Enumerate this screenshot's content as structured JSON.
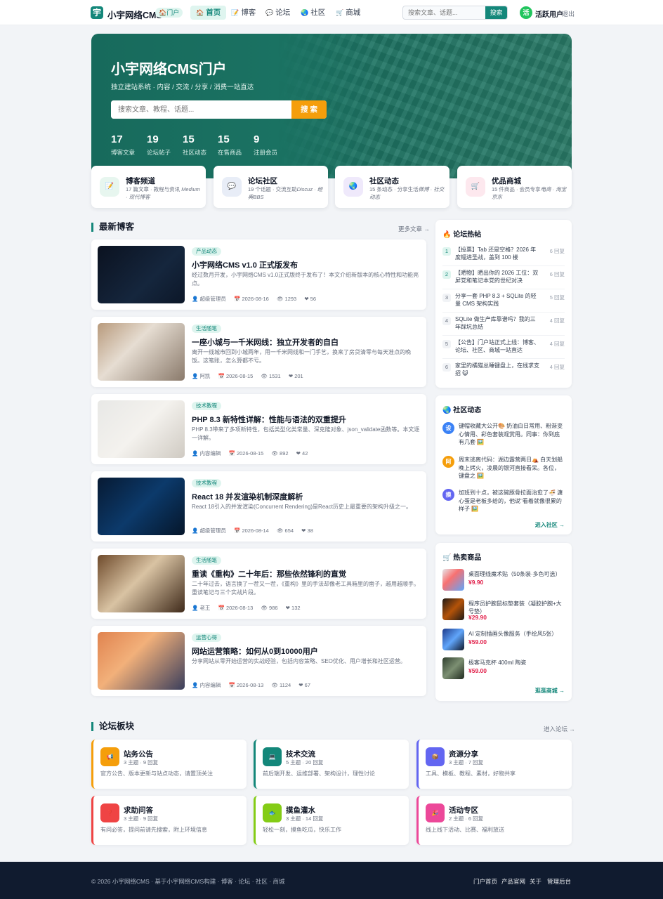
{
  "header": {
    "logo_char": "宇",
    "brand": "小宇网络CMS",
    "badge": "🏠门户",
    "nav": [
      {
        "icon": "🏠",
        "label": "首页"
      },
      {
        "icon": "📝",
        "label": "博客"
      },
      {
        "icon": "💬",
        "label": "论坛"
      },
      {
        "icon": "🌏",
        "label": "社区"
      },
      {
        "icon": "🛒",
        "label": "商城"
      }
    ],
    "search_placeholder": "搜索文章、话题...",
    "search_button": "搜索",
    "avatar_char": "活",
    "username": "活跃用户",
    "logout": "退出"
  },
  "hero": {
    "title": "小宇网络CMS门户",
    "subtitle": "独立建站系统 · 内容 / 交流 / 分享 / 消费一站直达",
    "search_placeholder": "搜索文章、教程、话题...",
    "search_button": "搜 索",
    "stats": [
      {
        "num": "17",
        "label": "博客文章"
      },
      {
        "num": "19",
        "label": "论坛帖子"
      },
      {
        "num": "15",
        "label": "社区动态"
      },
      {
        "num": "15",
        "label": "在售商品"
      },
      {
        "num": "9",
        "label": "注册会员"
      }
    ]
  },
  "channels": [
    {
      "icon": "📝",
      "title": "博客频道",
      "desc_plain": "17 篇文章 · 教程与资讯 ",
      "desc_em": "Medium · 现代博客"
    },
    {
      "icon": "💬",
      "title": "论坛社区",
      "desc_plain": "19 个话题 · 交流互助",
      "desc_em": "Discuz · 经典BBS"
    },
    {
      "icon": "🌏",
      "title": "社区动态",
      "desc_plain": "15 条动态 · 分享生活",
      "desc_em": "微博 · 社交动态"
    },
    {
      "icon": "🛒",
      "title": "优品商城",
      "desc_plain": "15 件商品 · 会员专享",
      "desc_em": "电商 · 淘宝京东"
    }
  ],
  "blog": {
    "title": "最新博客",
    "more": "更多文章 →",
    "posts": [
      {
        "tag": "产品动态",
        "title": "小宇网络CMS v1.0 正式版发布",
        "desc": "经过数月开发，小宇网络CMS v1.0正式版终于发布了！本文介绍新版本的核心特性和功能亮点。",
        "author": "超级管理员",
        "date": "2026-08-16",
        "views": "1293",
        "likes": "56"
      },
      {
        "tag": "生活随笔",
        "title": "一座小城与一千米网线：独立开发者的自白",
        "desc": "离开一线城市回到小城两年，用一千米网线和一门手艺，换来了房贷清零与每天准点的晚饭。这笔账，怎么算都不亏。",
        "author": "阿凯",
        "date": "2026-08-15",
        "views": "1531",
        "likes": "201"
      },
      {
        "tag": "技术教程",
        "title": "PHP 8.3 新特性详解：性能与语法的双重提升",
        "desc": "PHP 8.3带来了多项新特性，包括类型化类常量、深克隆对象、json_validate函数等。本文逐一详解。",
        "author": "内容编辑",
        "date": "2026-08-15",
        "views": "892",
        "likes": "42"
      },
      {
        "tag": "技术教程",
        "title": "React 18 并发渲染机制深度解析",
        "desc": "React 18引入的并发渲染(Concurrent Rendering)是React历史上最重要的架构升级之一。",
        "author": "超级管理员",
        "date": "2026-08-14",
        "views": "654",
        "likes": "38"
      },
      {
        "tag": "生活随笔",
        "title": "重读《重构》二十年后：那些依然锋利的直觉",
        "desc": "二十年过去，语言换了一茬又一茬，《重构》里的手法却像老工具箱里的凿子，越用越顺手。重读笔记与三个实战片段。",
        "author": "老王",
        "date": "2026-08-13",
        "views": "986",
        "likes": "132"
      },
      {
        "tag": "运营心得",
        "title": "网站运营策略：如何从0到10000用户",
        "desc": "分享网站从零开始运营的实战经验，包括内容策略、SEO优化、用户增长和社区运营。",
        "author": "内容编辑",
        "date": "2026-08-13",
        "views": "1124",
        "likes": "67"
      }
    ]
  },
  "forum_hot": {
    "title": "🔥 论坛热帖",
    "items": [
      {
        "rank": "1",
        "text": "【投票】Tab 还是空格？2026 年度幅进圣战，盖到 100 楼",
        "replies": "6 回复"
      },
      {
        "rank": "2",
        "text": "【晒物】晒出你的 2026 工位：双屏党和笔记本党的世纪对决",
        "replies": "6 回复"
      },
      {
        "rank": "3",
        "text": "分享一套 PHP 8.3 + SQLite 的轻量 CMS 架构实践",
        "replies": "5 回复"
      },
      {
        "rank": "4",
        "text": "SQLite 做生产库靠谱吗？我的三年踩坑总结",
        "replies": "4 回复"
      },
      {
        "rank": "5",
        "text": "【公告】门户站正式上线：博客、论坛、社区、商城一站直达",
        "replies": "4 回复"
      },
      {
        "rank": "6",
        "text": "家里的橘猫总睡键盘上，在线求支招 😺",
        "replies": "4 回复"
      }
    ]
  },
  "community": {
    "title": "🌏 社区动态",
    "items": [
      {
        "avatar": "设",
        "color": "#3b82f6",
        "text": "键帽收藏大公开🎨 奶油白日常用、粉渐变心情用、彩色套装观赏用。同事：你到底有几套 🖼️"
      },
      {
        "avatar": "阿",
        "color": "#f59e0b",
        "text": "周末逃离代码：湖边露营两日⛺ 白天划船晚上烤火，凌晨的银河直接看呆。各位，键盘之 🖼️"
      },
      {
        "avatar": "摸",
        "color": "#6366f1",
        "text": "加班到十点，被这碗豚骨拉面治愈了🍜 溏心蛋是老板多给的，他说\"看着就像很累的样子 🖼️"
      }
    ],
    "more": "进入社区 →"
  },
  "shop": {
    "title": "🛒 热卖商品",
    "items": [
      {
        "name": "桌面理线魔术贴（50条装·多色可选）",
        "price": "¥9.90",
        "bg": "linear-gradient(135deg,#e5e7eb,#f87171 40%,#60a5fa)"
      },
      {
        "name": "程序员护腕鼠标垫套装（凝胶护腕+大号垫）",
        "price": "¥29.90",
        "bg": "linear-gradient(135deg,#1f1a17,#b45309 50%,#1c1917)"
      },
      {
        "name": "AI 定制插画头像服务（手绘风5张）",
        "price": "¥59.00",
        "bg": "linear-gradient(135deg,#1e3a8a,#60a5fa 50%,#0f172a)"
      },
      {
        "name": "极客马克杯 400ml 陶瓷",
        "price": "¥59.00",
        "bg": "linear-gradient(135deg,#2f3f2f,#7c8f72 50%,#1f2a1f)"
      }
    ],
    "more": "逛逛商城 →"
  },
  "boards": {
    "title": "论坛板块",
    "more": "进入论坛 →",
    "items": [
      {
        "icon": "📢",
        "name": "站务公告",
        "stats": "3 主题 · 9 回复",
        "desc": "官方公告、版本更新与站点动态，请置顶关注",
        "color": "#f59e0b"
      },
      {
        "icon": "💻",
        "name": "技术交流",
        "stats": "5 主题 · 20 回复",
        "desc": "前后端开发、运维部署、架构设计，理性讨论",
        "color": "#14877a"
      },
      {
        "icon": "📦",
        "name": "资源分享",
        "stats": "3 主题 · 7 回复",
        "desc": "工具、模板、教程、素材，好物共享",
        "color": "#6366f1"
      },
      {
        "icon": "❓",
        "name": "求助问答",
        "stats": "3 主题 · 9 回复",
        "desc": "有问必答，提问前请先搜索，附上环境信息",
        "color": "#ef4444"
      },
      {
        "icon": "🐟",
        "name": "摸鱼灌水",
        "stats": "3 主题 · 14 回复",
        "desc": "轻松一刻，摸鱼吃瓜，快乐工作",
        "color": "#84cc16"
      },
      {
        "icon": "🎉",
        "name": "活动专区",
        "stats": "2 主题 · 6 回复",
        "desc": "线上线下活动、比赛、福利放送",
        "color": "#ec4899"
      }
    ]
  },
  "footer": {
    "copyright": "© 2026 小宇网络CMS · 基于小宇网络CMS构建 · 博客 · 论坛 · 社区 · 商城",
    "links": [
      "门户首页",
      "产品官网",
      "关于",
      "管理后台"
    ]
  }
}
